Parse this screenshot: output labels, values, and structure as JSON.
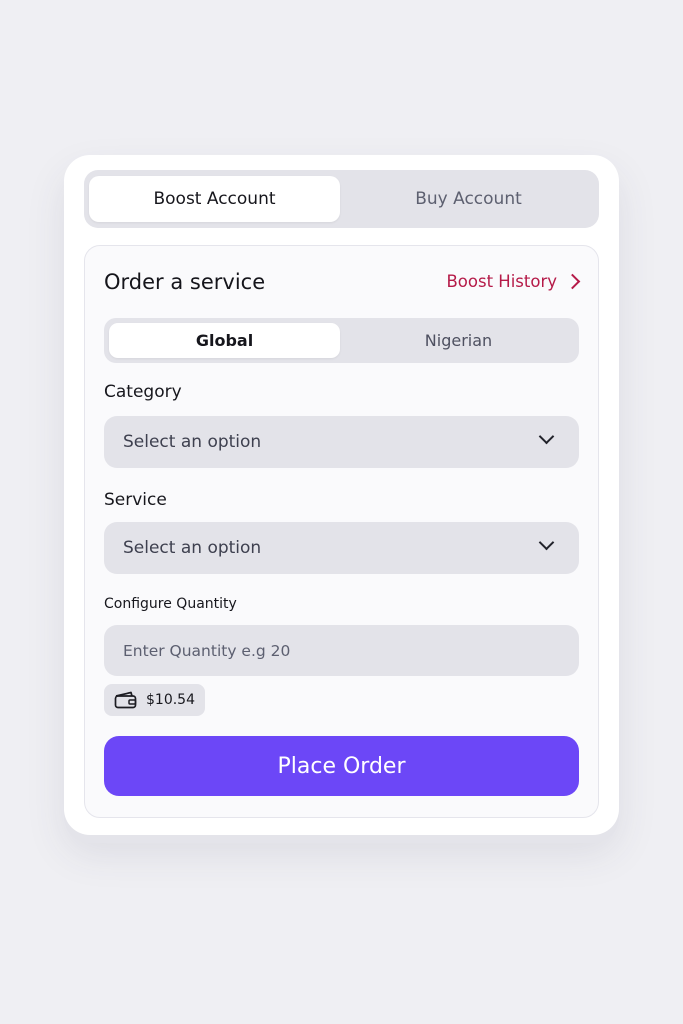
{
  "tabs": {
    "boost_label": "Boost Account",
    "buy_label": "Buy Account"
  },
  "panel": {
    "title": "Order a service",
    "history_label": "Boost History"
  },
  "region_tabs": {
    "global_label": "Global",
    "nigerian_label": "Nigerian"
  },
  "category": {
    "label": "Category",
    "value": "Select an option"
  },
  "service": {
    "label": "Service",
    "value": "Select an option"
  },
  "quantity": {
    "label": "Configure Quantity",
    "placeholder": "Enter Quantity e.g 20"
  },
  "balance": {
    "amount": "$10.54",
    "icon": "wallet-icon"
  },
  "submit": {
    "label": "Place Order"
  },
  "colors": {
    "accent": "#6c47f7",
    "link": "#b51a48",
    "field_bg": "#e3e3e9"
  }
}
